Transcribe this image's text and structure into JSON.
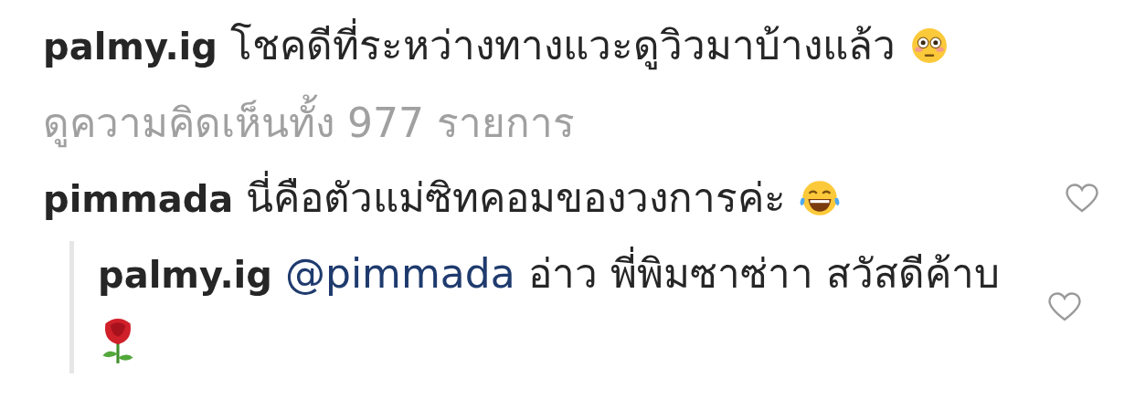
{
  "caption": {
    "username": "palmy.ig",
    "text": "โชคดีที่ระหว่างทางแวะดูวิวมาบ้างแล้ว",
    "emoji": {
      "kind": "flushed"
    }
  },
  "view_all": "ดูความคิดเห็นทั้ง 977 รายการ",
  "comments": [
    {
      "username": "pimmada",
      "text": "นี่คือตัวแม่ซิทคอมของวงการค่ะ",
      "emoji": {
        "kind": "joy"
      },
      "liked": false,
      "replies": [
        {
          "username": "palmy.ig",
          "mention": "@pimmada",
          "text": "อ่าว พี่พิมซาซ่าา สวัสดีค้าบ",
          "emoji": {
            "kind": "rose"
          },
          "liked": false
        }
      ]
    }
  ]
}
